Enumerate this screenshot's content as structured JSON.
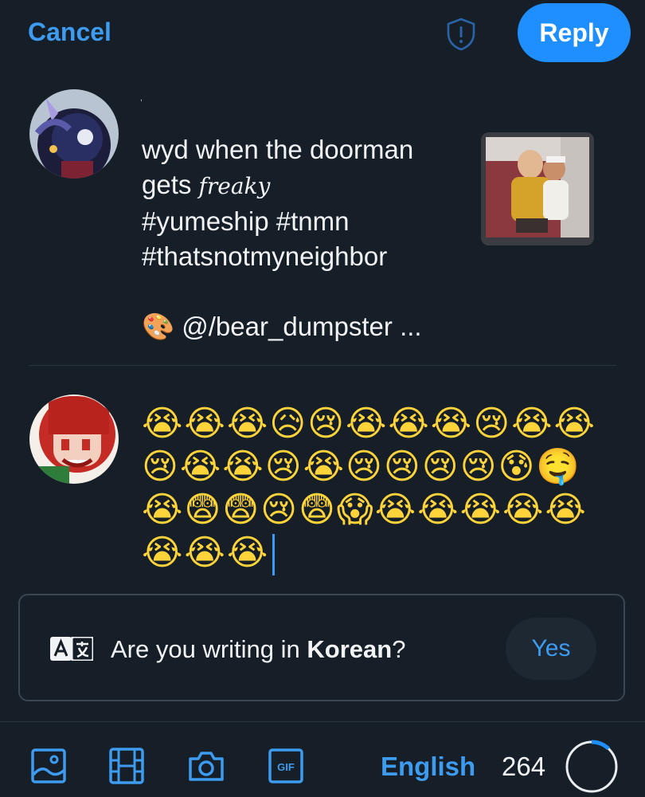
{
  "header": {
    "cancel_label": "Cancel",
    "reply_label": "Reply"
  },
  "parent_post": {
    "tiny_text": ",",
    "text_lines": [
      "wyd when the doorman",
      "gets ",
      "#yumeship #tnmn",
      "#thatsnotmyneighbor"
    ],
    "freaky_word": "freaky",
    "credit_emoji": "🎨",
    "credit_text": "@/bear_dumpster ..."
  },
  "reply": {
    "emoji_text": "😭😭😭😥😢😭😭😭😢😭😭😢😭😭😢😭😢😢😢😢😰🤤😭😨😨😢😨😱😭😭😭😭😭😭😭😭"
  },
  "language_prompt": {
    "question_prefix": "Are you writing in ",
    "language": "Korean",
    "question_suffix": "?",
    "yes_label": "Yes",
    "icon_letters": "A文"
  },
  "toolbar": {
    "language_label": "English",
    "char_count": "264",
    "progress_fraction": 0.12,
    "gif_label": "GIF"
  },
  "colors": {
    "accent": "#1f8fff",
    "link": "#3d9bf0",
    "background": "#161e27"
  }
}
